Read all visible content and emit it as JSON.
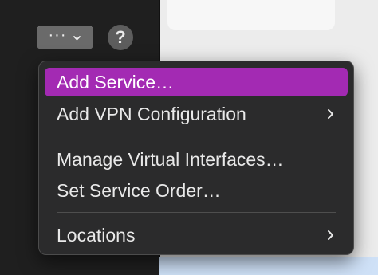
{
  "toolbar": {
    "action_button_label": "···",
    "help_button_label": "?"
  },
  "menu": {
    "items": [
      {
        "label": "Add Service…",
        "highlighted": true,
        "has_submenu": false
      },
      {
        "label": "Add VPN Configuration",
        "highlighted": false,
        "has_submenu": true
      },
      {
        "label": "Manage Virtual Interfaces…",
        "highlighted": false,
        "has_submenu": false
      },
      {
        "label": "Set Service Order…",
        "highlighted": false,
        "has_submenu": false
      },
      {
        "label": "Locations",
        "highlighted": false,
        "has_submenu": true
      }
    ]
  },
  "colors": {
    "highlight": "#a32ab3",
    "menu_background": "#2b2b2c",
    "sidebar_background": "#1f1f1f"
  }
}
